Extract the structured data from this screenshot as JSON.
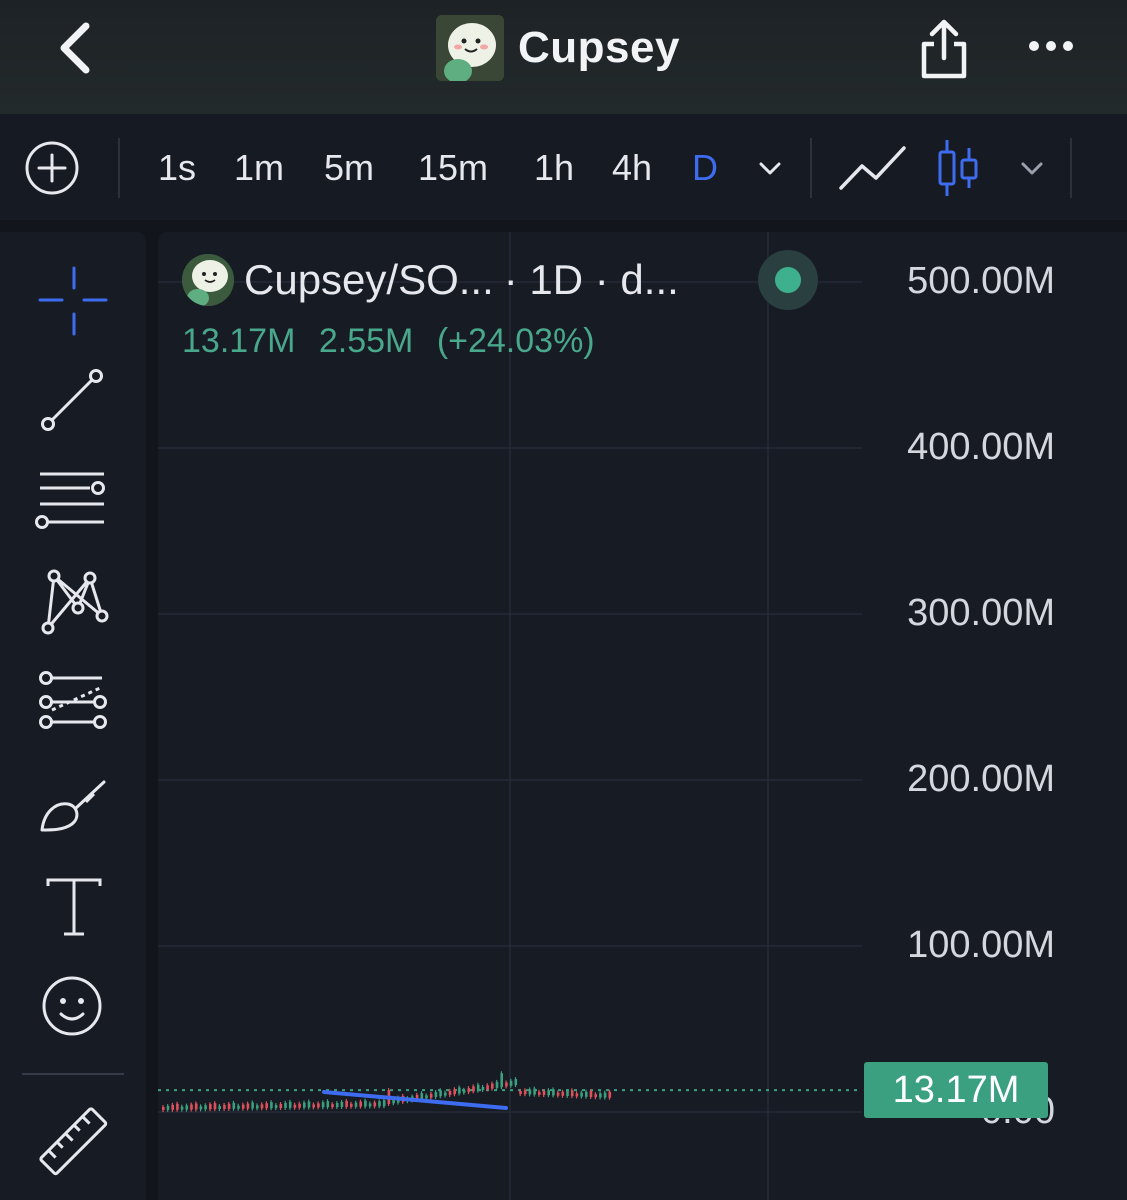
{
  "header": {
    "title": "Cupsey"
  },
  "toolbar": {
    "timeframes": [
      "1s",
      "1m",
      "5m",
      "15m",
      "1h",
      "4h",
      "D"
    ],
    "active_timeframe": "D"
  },
  "chart": {
    "legend": {
      "symbol": "Cupsey/SO...",
      "interval": " · 1D · d..."
    },
    "ohlc": {
      "value": "13.17M",
      "change": "2.55M",
      "change_pct": "(+24.03%)"
    },
    "current_price": "13.17M",
    "colors": {
      "up": "#3aa07f",
      "down": "#e0505a",
      "trend_line": "#3d6cf0",
      "accent": "#3d6cf0"
    }
  },
  "chart_data": {
    "type": "line",
    "ylim": [
      0,
      500000000
    ],
    "y_ticks": [
      "500.00M",
      "400.00M",
      "300.00M",
      "200.00M",
      "100.00M",
      "0.00"
    ],
    "last_price": 13170000
  }
}
